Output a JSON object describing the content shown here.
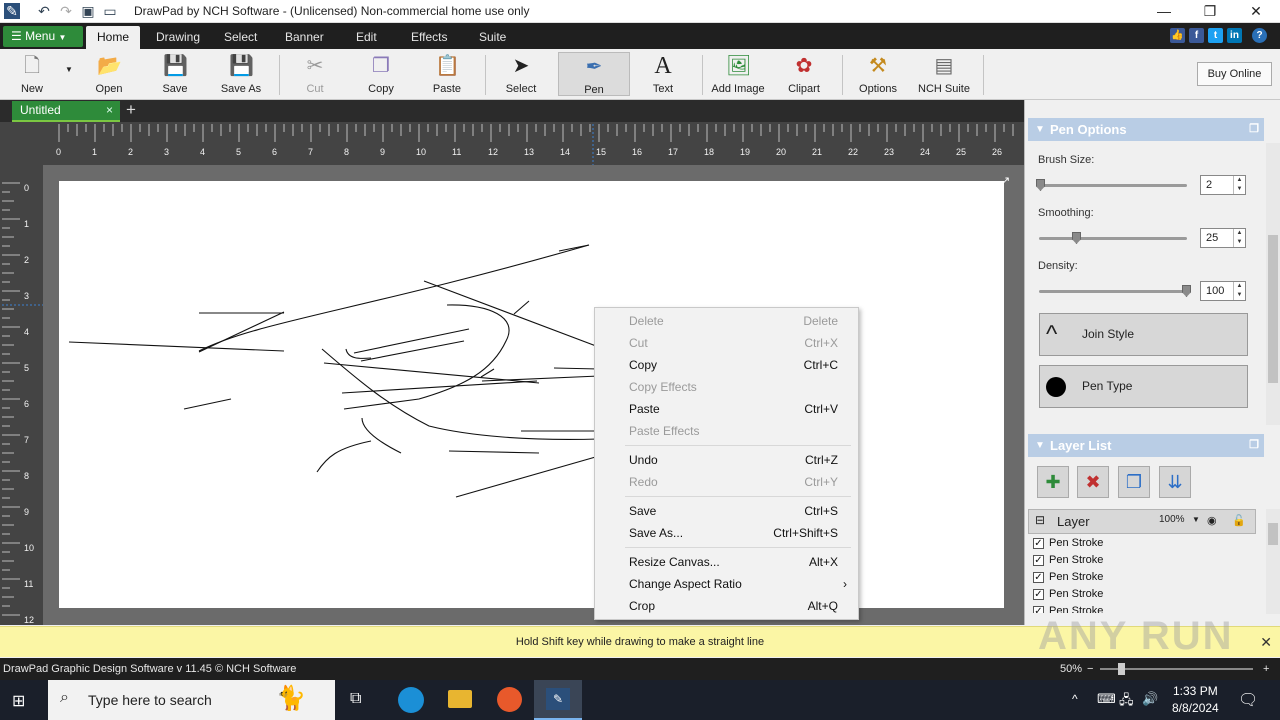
{
  "window": {
    "title": "DrawPad by NCH Software - (Unlicensed) Non-commercial home use only",
    "controls": [
      "—",
      "❐",
      "✕"
    ]
  },
  "ribbon": {
    "menu_label": "Menu",
    "tabs": [
      "Home",
      "Drawing",
      "Select",
      "Banner",
      "Edit",
      "Effects",
      "Suite"
    ],
    "active_tab": "Home"
  },
  "toolbar": {
    "new": "New",
    "open": "Open",
    "save": "Save",
    "save_as": "Save As",
    "cut": "Cut",
    "copy": "Copy",
    "paste": "Paste",
    "select": "Select",
    "pen": "Pen",
    "text": "Text",
    "add_image": "Add Image",
    "clipart": "Clipart",
    "options": "Options",
    "nch_suite": "NCH Suite",
    "buy_online": "Buy Online"
  },
  "document_tab": {
    "name": "Untitled",
    "close": "×",
    "new": "+"
  },
  "rulers": {
    "h": [
      "0",
      "1",
      "2",
      "3",
      "4",
      "5",
      "6",
      "7",
      "8",
      "9",
      "10",
      "11",
      "12",
      "13",
      "14",
      "15",
      "16",
      "17",
      "18",
      "19",
      "20",
      "21",
      "22",
      "23",
      "24",
      "25",
      "26"
    ],
    "v": [
      "0",
      "1",
      "2",
      "3",
      "4",
      "5",
      "6",
      "7",
      "8",
      "9",
      "10",
      "11",
      "12"
    ]
  },
  "context_menu": [
    {
      "label": "Delete",
      "shortcut": "Delete",
      "enabled": false
    },
    {
      "label": "Cut",
      "shortcut": "Ctrl+X",
      "enabled": false
    },
    {
      "label": "Copy",
      "shortcut": "Ctrl+C",
      "enabled": true
    },
    {
      "label": "Copy Effects",
      "shortcut": "",
      "enabled": false
    },
    {
      "label": "Paste",
      "shortcut": "Ctrl+V",
      "enabled": true
    },
    {
      "label": "Paste Effects",
      "shortcut": "",
      "enabled": false
    },
    {
      "label": "Undo",
      "shortcut": "Ctrl+Z",
      "enabled": true
    },
    {
      "label": "Redo",
      "shortcut": "Ctrl+Y",
      "enabled": false
    },
    {
      "label": "Save",
      "shortcut": "Ctrl+S",
      "enabled": true
    },
    {
      "label": "Save As...",
      "shortcut": "Ctrl+Shift+S",
      "enabled": true
    },
    {
      "label": "Resize Canvas...",
      "shortcut": "Alt+X",
      "enabled": true
    },
    {
      "label": "Change Aspect Ratio",
      "shortcut": "›",
      "enabled": true
    },
    {
      "label": "Crop",
      "shortcut": "Alt+Q",
      "enabled": true
    }
  ],
  "pen_options": {
    "title": "Pen Options",
    "brush_size_label": "Brush Size:",
    "brush_size": "2",
    "smoothing_label": "Smoothing:",
    "smoothing": "25",
    "density_label": "Density:",
    "density": "100",
    "join_style": "Join Style",
    "pen_type": "Pen Type"
  },
  "layer_list": {
    "title": "Layer List",
    "layer_name": "Layer",
    "opacity": "100%",
    "items": [
      "Pen Stroke",
      "Pen Stroke",
      "Pen Stroke",
      "Pen Stroke",
      "Pen Stroke"
    ]
  },
  "hint": "Hold Shift key while drawing to make a straight line",
  "status": {
    "version": "DrawPad Graphic Design Software v 11.45 © NCH Software",
    "zoom": "50%"
  },
  "taskbar": {
    "search_placeholder": "Type here to search",
    "time": "1:33 PM",
    "date": "8/8/2024"
  },
  "watermark": "ANY RUN"
}
